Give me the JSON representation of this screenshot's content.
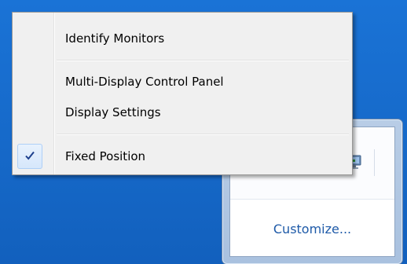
{
  "menu": {
    "items": [
      {
        "label": "Identify Monitors"
      },
      {
        "label": "Multi-Display Control Panel"
      },
      {
        "label": "Display Settings"
      },
      {
        "label": "Fixed Position",
        "checked": true
      }
    ],
    "check_icon": "checkmark-icon"
  },
  "flyout": {
    "customize_label": "Customize...",
    "tray_icon": "monitor-icon"
  },
  "colors": {
    "desktop": "#1669c9",
    "menu_bg": "#f0f0f0",
    "link": "#1e5aa8",
    "check": "#1c3f8c"
  }
}
